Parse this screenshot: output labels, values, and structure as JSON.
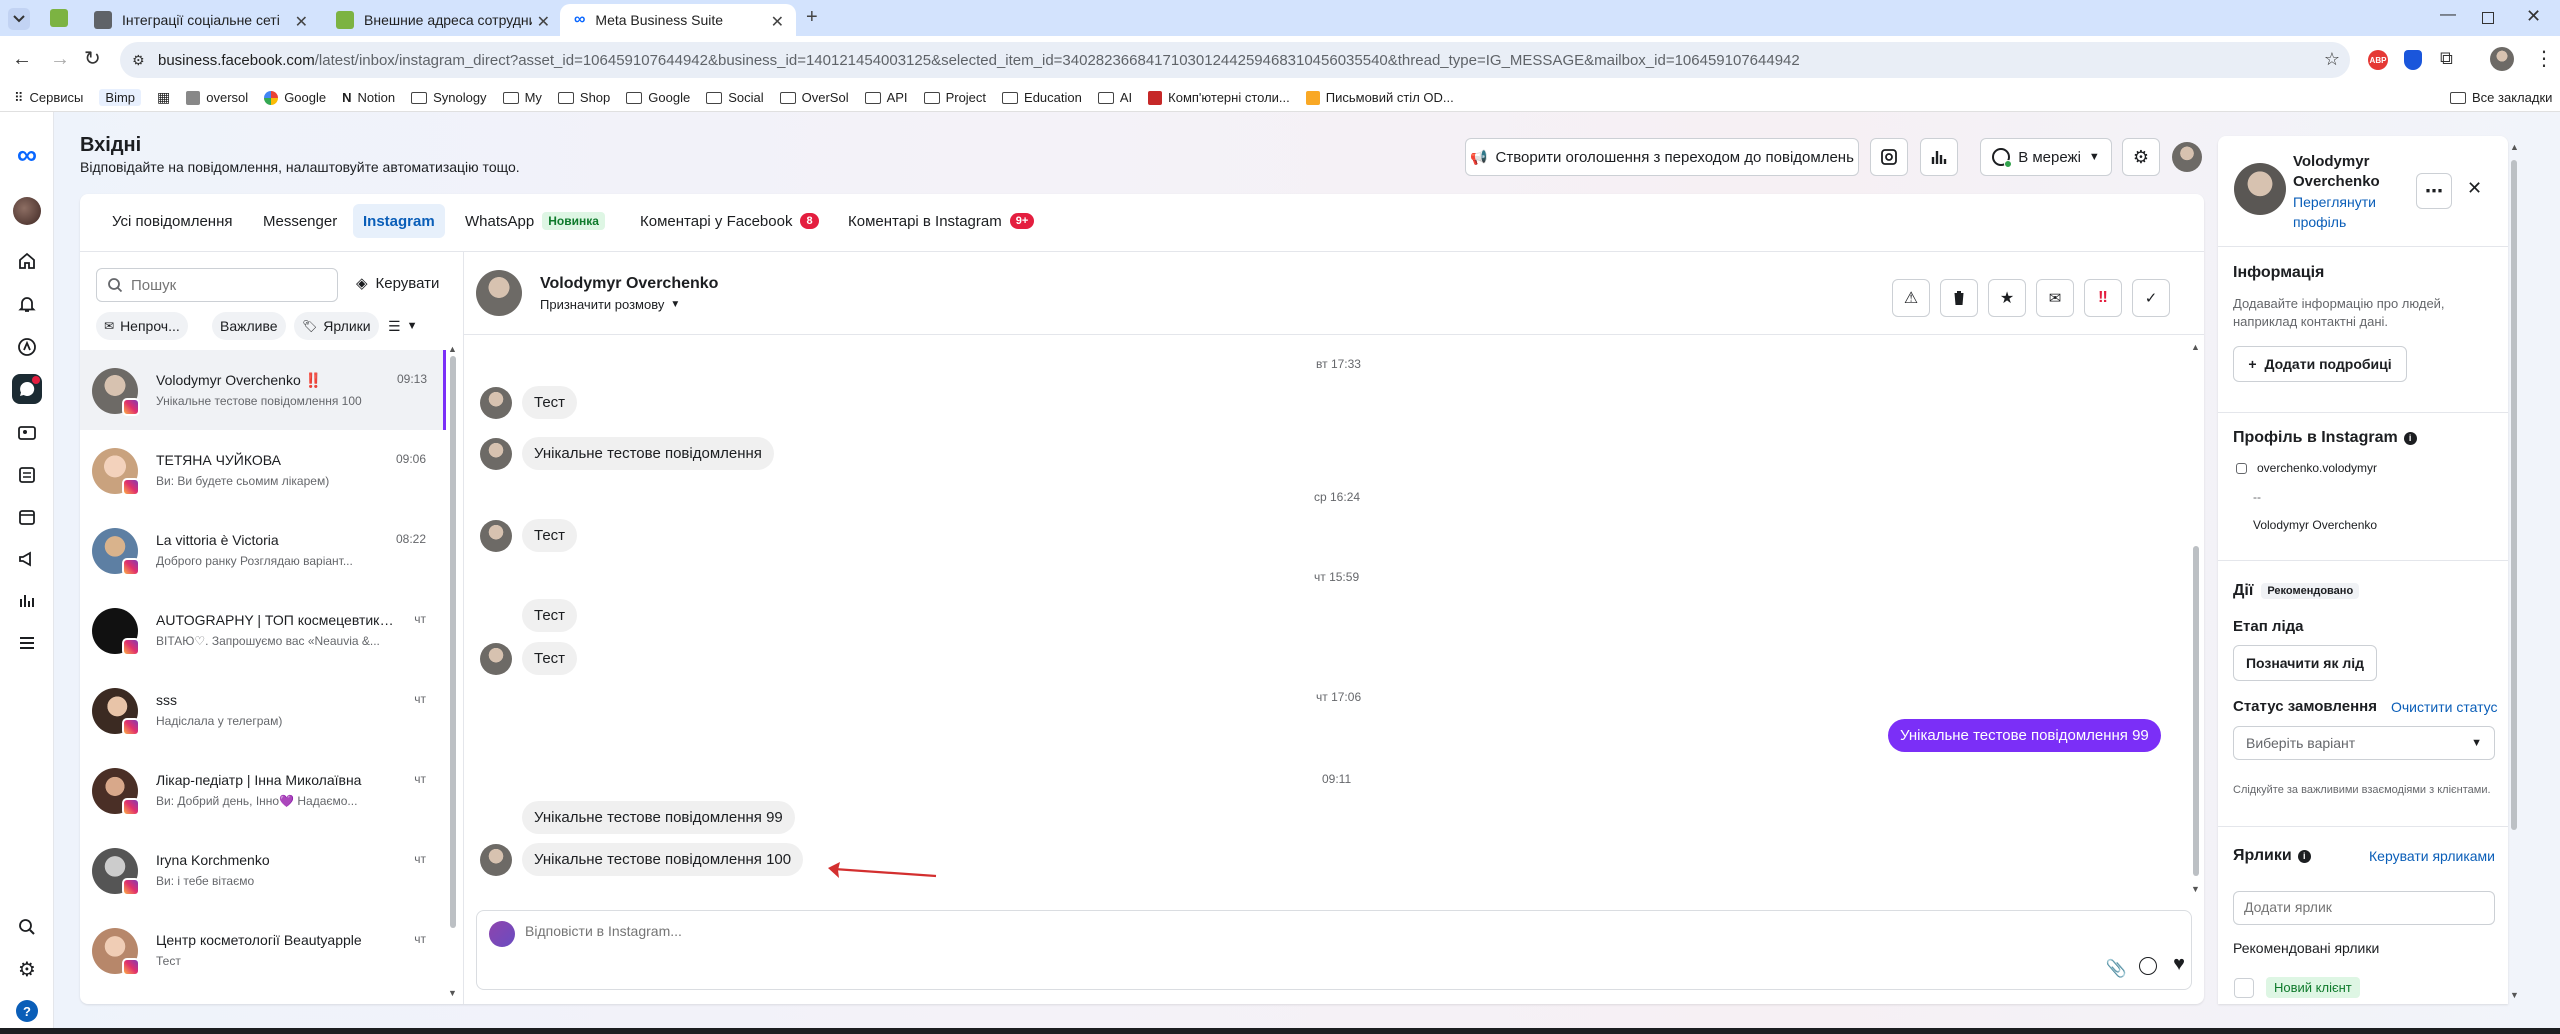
{
  "browser": {
    "tabs": [
      {
        "label": "Інтеграції соціальне сеті"
      },
      {
        "label": "Внешние адреса сотрудников"
      },
      {
        "label": "Meta Business Suite"
      }
    ],
    "url_host": "business.facebook.com",
    "url_path": "/latest/inbox/instagram_direct?asset_id=106459107644942&business_id=140121454003125&selected_item_id=340282366841710301244259468310456035540&thread_type=IG_MESSAGE&mailbox_id=106459107644942",
    "bookmarks": [
      "Сервисы",
      "Bimp",
      "",
      "oversol",
      "Google",
      "Notion",
      "Synology",
      "My",
      "Shop",
      "Google",
      "Social",
      "OverSol",
      "API",
      "Project",
      "Education",
      "AI",
      "Комп'ютерні столи...",
      "Письмовий стіл OD..."
    ],
    "bookmarks_right": "Все закладки",
    "ext_badge": "ABP"
  },
  "header": {
    "title": "Вхідні",
    "subtitle": "Відповідайте на повідомлення, налаштовуйте автоматизацію тощо.",
    "create_ad_button": "Створити оголошення з переходом до повідомлень",
    "status_button": "В мережі"
  },
  "channel_tabs": [
    {
      "label": "Усі повідомлення"
    },
    {
      "label": "Messenger"
    },
    {
      "label": "Instagram"
    },
    {
      "label": "WhatsApp",
      "badge": "Новинка"
    },
    {
      "label": "Коментарі у Facebook",
      "count": "8"
    },
    {
      "label": "Коментарі в Instagram",
      "count": "9+"
    }
  ],
  "list": {
    "search_placeholder": "Пошук",
    "manage_label": "Керувати",
    "filters": [
      "Непроч...",
      "Важливе",
      "Ярлики"
    ],
    "conversations": [
      {
        "name": "Volodymyr Overchenko ‼️",
        "snippet": "Унікальне тестове повідомлення 100",
        "time": "09:13"
      },
      {
        "name": "ТЕТЯНА ЧУЙКОВА",
        "snippet": "Ви: Ви будете сьомим лікарем)",
        "time": "09:06"
      },
      {
        "name": "La vittoria è Victoria",
        "snippet": "Доброго ранку Розглядаю варіант...",
        "time": "08:22"
      },
      {
        "name": "AUTOGRAPHY | ТОП космецевтика ...",
        "snippet": "ВІТАЮ♡. Запрошуємо вас «Neauvia &...",
        "time": "чт"
      },
      {
        "name": "sss",
        "snippet": "Надіслала у телеграм)",
        "time": "чт"
      },
      {
        "name": "Лікар-педіатр | Інна Миколаївна",
        "snippet": "Ви: Добрий день, Інно💜 Надаємо...",
        "time": "чт"
      },
      {
        "name": "Iryna Korchmenko",
        "snippet": "Ви: і тебе вітаємо",
        "time": "чт"
      },
      {
        "name": "Центр косметології Beautyapple",
        "snippet": "Тест",
        "time": "чт"
      }
    ]
  },
  "thread": {
    "contact_name": "Volodymyr Overchenko",
    "assign_label": "Призначити розмову",
    "messages": [
      {
        "type": "sep",
        "text": "вт 17:33"
      },
      {
        "type": "in",
        "text": "Тест"
      },
      {
        "type": "in",
        "text": "Унікальне тестове повідомлення"
      },
      {
        "type": "sep",
        "text": "ср 16:24"
      },
      {
        "type": "in",
        "text": "Тест"
      },
      {
        "type": "sep",
        "text": "чт 15:59"
      },
      {
        "type": "in",
        "text": "Тест"
      },
      {
        "type": "in",
        "text": "Тест"
      },
      {
        "type": "sep",
        "text": "чт 17:06"
      },
      {
        "type": "out",
        "text": "Унікальне тестове повідомлення 99"
      },
      {
        "type": "sep",
        "text": "09:11"
      },
      {
        "type": "in",
        "text": "Унікальне тестове повідомлення 99"
      },
      {
        "type": "in",
        "text": "Унікальне тестове повідомлення 100"
      }
    ],
    "composer_placeholder": "Відповісти в Instagram..."
  },
  "profile": {
    "name": "Volodymyr Overchenko",
    "view_link": "Переглянути профіль",
    "info_title": "Інформація",
    "info_text": "Додавайте інформацію про людей, наприклад контактні дані.",
    "add_details_button": "Додати подробиці",
    "ig_title": "Профіль в Instagram",
    "ig_username": "overchenko.volodymyr",
    "ig_dash": "--",
    "ig_fullname": "Volodymyr Overchenko",
    "actions_title": "Дії",
    "actions_badge": "Рекомендовано",
    "lead_stage_title": "Етап ліда",
    "mark_lead_button": "Позначити як лід",
    "order_status_title": "Статус замовлення",
    "clear_status_link": "Очистити статус",
    "order_select": "Виберіть варіант",
    "order_hint": "Слідкуйте за важливими взаємодіями з клієнтами.",
    "labels_title": "Ярлики",
    "manage_labels_link": "Керувати ярликами",
    "add_label_placeholder": "Додати ярлик",
    "recommended_labels": "Рекомендовані ярлики",
    "new_client_label": "Новий клієнт"
  },
  "colors": {
    "accent": "#0a5eb8",
    "outgoing": "#7b2ff7",
    "red": "#e41e3f"
  }
}
